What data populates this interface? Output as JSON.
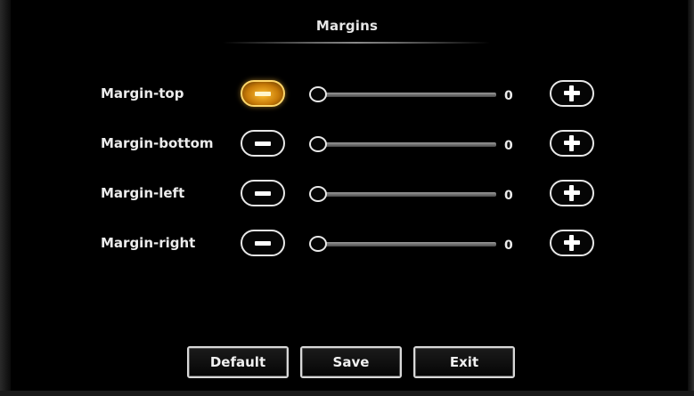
{
  "title": "Margins",
  "rows": [
    {
      "label": "Margin-top",
      "value": "0",
      "level": 0,
      "minus_active": true
    },
    {
      "label": "Margin-bottom",
      "value": "0",
      "level": 0,
      "minus_active": false
    },
    {
      "label": "Margin-left",
      "value": "0",
      "level": 0,
      "minus_active": false
    },
    {
      "label": "Margin-right",
      "value": "0",
      "level": 0,
      "minus_active": false
    }
  ],
  "icons": {
    "decrease": "minus-icon",
    "increase": "plus-icon"
  },
  "footer": {
    "default_label": "Default",
    "save_label": "Save",
    "exit_label": "Exit"
  },
  "colors": {
    "background": "#000000",
    "focus_highlight": "#f2a51a",
    "text": "#ececec"
  }
}
